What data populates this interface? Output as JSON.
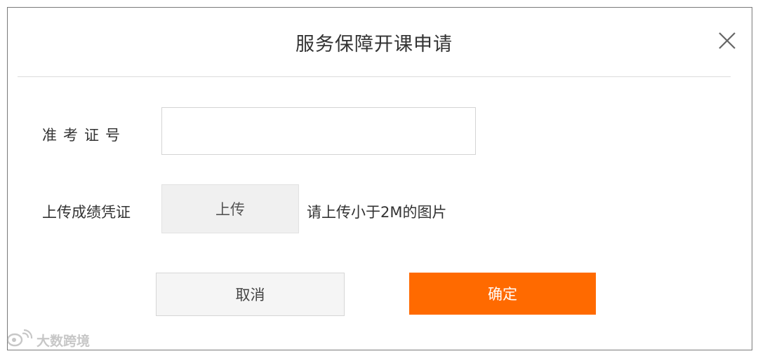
{
  "dialog": {
    "title": "服务保障开课申请",
    "close_icon": "close-icon"
  },
  "form": {
    "exam_id_label": "准考证号",
    "exam_id_value": "",
    "exam_id_placeholder": "",
    "upload_label": "上传成绩凭证",
    "upload_button": "上传",
    "upload_hint": "请上传小于2M的图片"
  },
  "actions": {
    "cancel": "取消",
    "confirm": "确定"
  },
  "watermark": {
    "icon": "weibo-logo-icon",
    "text": "大数跨境"
  },
  "colors": {
    "primary": "#ff6a00",
    "border": "#d4d4d4",
    "upload_bg": "#f0f0f0"
  }
}
